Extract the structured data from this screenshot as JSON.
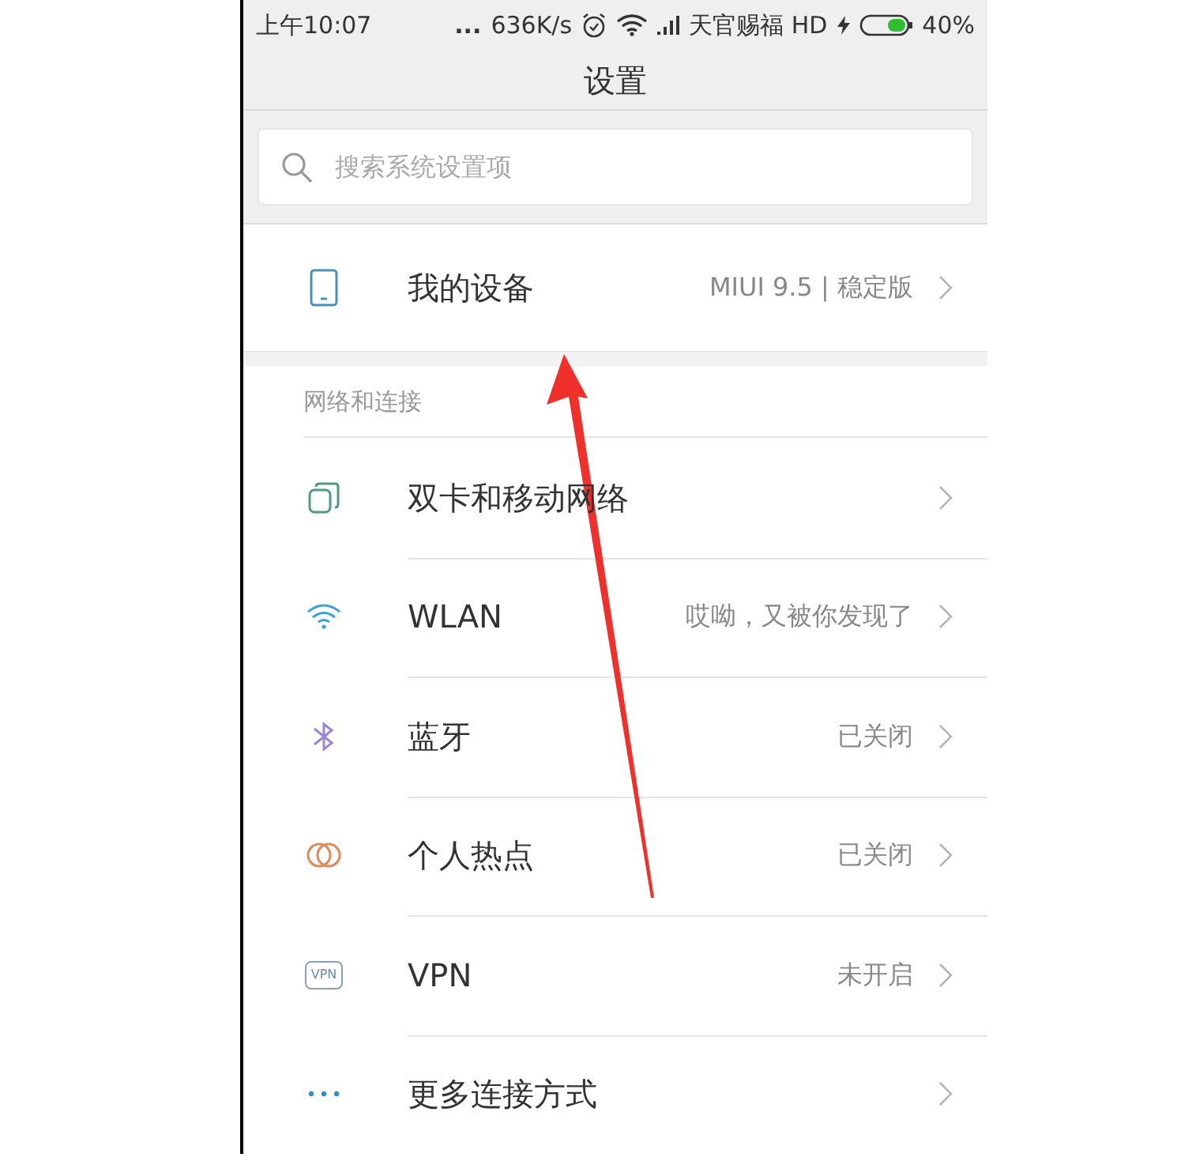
{
  "status_bar": {
    "time": "上午10:07",
    "dots": "...",
    "speed": "636K/s",
    "carrier": "天官赐福 HD",
    "battery": "40%"
  },
  "title": "设置",
  "search": {
    "placeholder": "搜索系统设置项"
  },
  "device_row": {
    "kind": "device",
    "label": "我的设备",
    "value": "MIUI 9.5 | 稳定版"
  },
  "section": {
    "header": "网络和连接",
    "items": [
      {
        "kind": "sim",
        "label": "双卡和移动网络"
      },
      {
        "kind": "wifi",
        "label": "WLAN",
        "value": "哎呦，又被你发现了"
      },
      {
        "kind": "bluetooth",
        "label": "蓝牙",
        "value": "已关闭"
      },
      {
        "kind": "hotspot",
        "label": "个人热点",
        "value": "已关闭"
      },
      {
        "kind": "vpn",
        "icon_text": "VPN",
        "label": "VPN",
        "value": "未开启"
      },
      {
        "kind": "more",
        "label": "更多连接方式"
      }
    ]
  }
}
